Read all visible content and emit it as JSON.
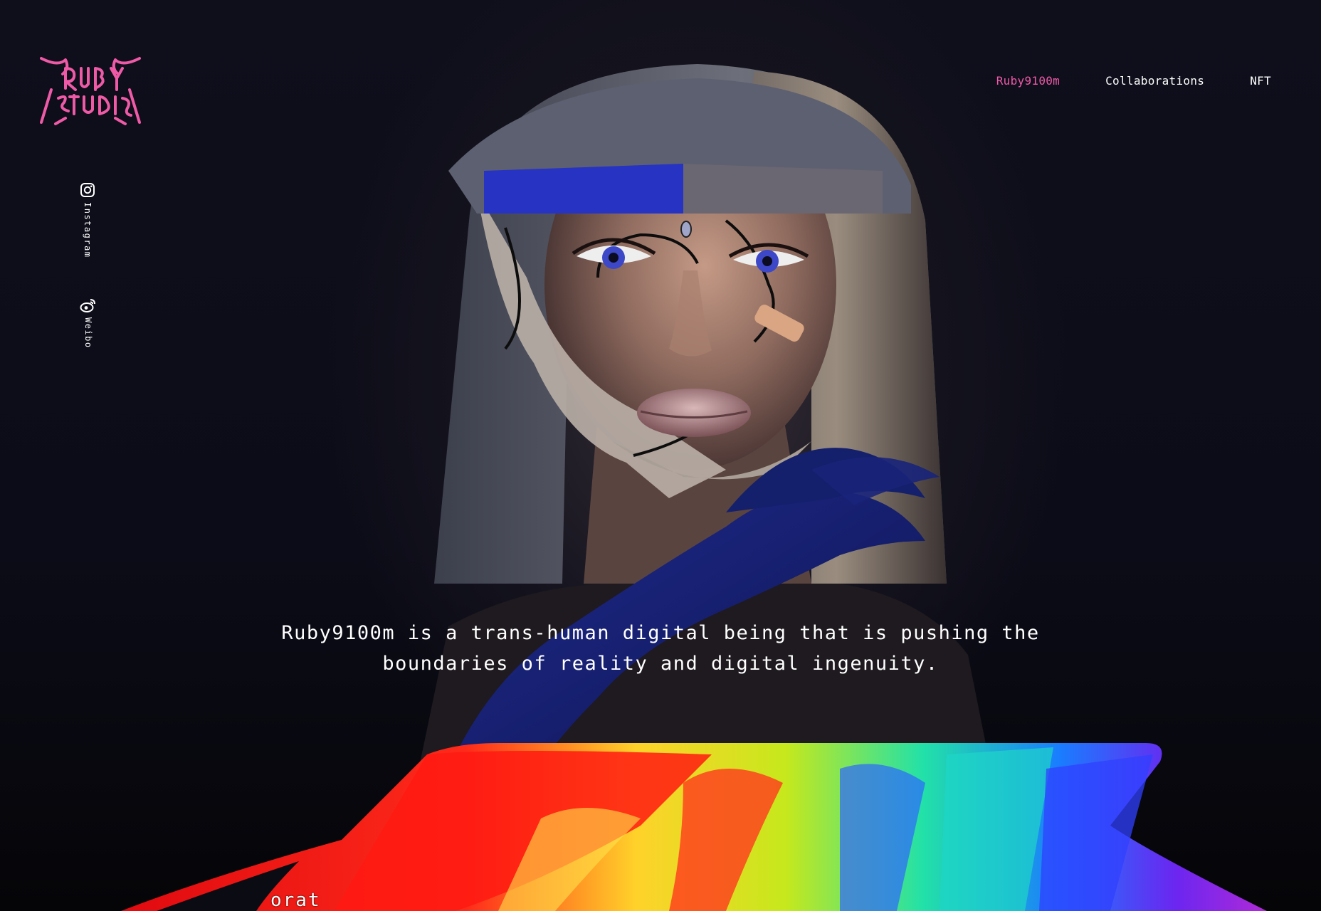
{
  "brand": {
    "logo_text": "RUBY STUDIO",
    "accent_color": "#ef5aa7"
  },
  "nav": {
    "items": [
      {
        "label": "Ruby9100m",
        "active": true
      },
      {
        "label": "Collaborations",
        "active": false
      },
      {
        "label": "NFT",
        "active": false
      }
    ]
  },
  "social": {
    "instagram_label": "Instagram",
    "instagram_icon": "instagram-icon",
    "weibo_label": "Weibo",
    "weibo_icon": "weibo-icon"
  },
  "hero": {
    "tagline_line1": "Ruby9100m is a trans-human digital being that is pushing the",
    "tagline_line2": "boundaries of reality and digital ingenuity."
  },
  "next_section": {
    "partial_heading": "orat"
  },
  "colors": {
    "background": "#0b0b14",
    "text": "#ffffff",
    "accent": "#ef5aa7"
  }
}
